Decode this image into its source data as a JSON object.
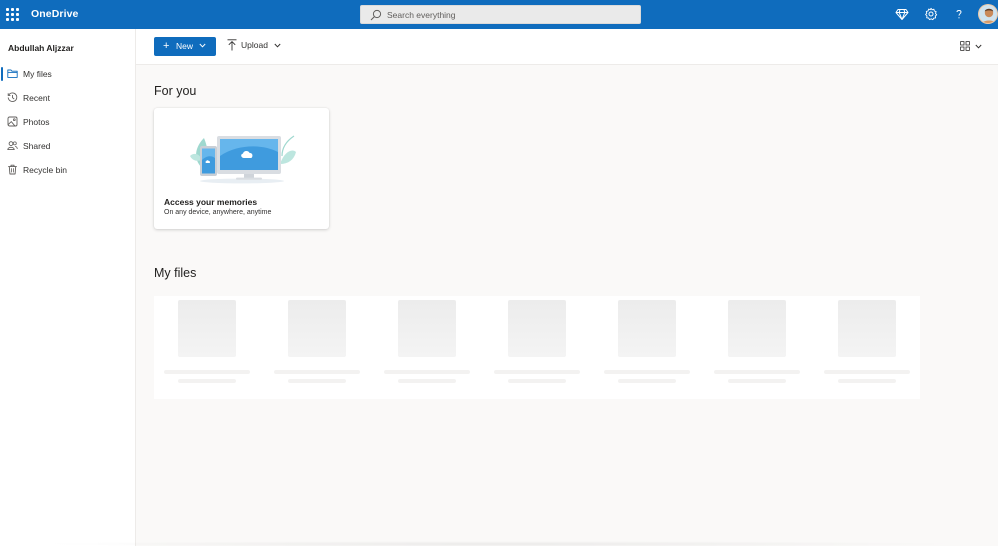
{
  "app": {
    "name": "OneDrive"
  },
  "search": {
    "placeholder": "Search everything"
  },
  "header_icons": [
    "diamond-icon",
    "gear-icon",
    "help-icon",
    "avatar"
  ],
  "user": {
    "name": "Abdullah Aljzzar"
  },
  "nav": {
    "items": [
      {
        "label": "My files",
        "icon": "folder-icon",
        "active": true
      },
      {
        "label": "Recent",
        "icon": "recent-icon",
        "active": false
      },
      {
        "label": "Photos",
        "icon": "photos-icon",
        "active": false
      },
      {
        "label": "Shared",
        "icon": "shared-icon",
        "active": false
      },
      {
        "label": "Recycle bin",
        "icon": "trash-icon",
        "active": false
      }
    ]
  },
  "toolbar": {
    "new_label": "New",
    "upload_label": "Upload"
  },
  "for_you": {
    "title": "For you",
    "card": {
      "title": "Access your memories",
      "subtitle": "On any device, anywhere, anytime"
    }
  },
  "my_files": {
    "title": "My files",
    "placeholder_tiles": 7
  },
  "colors": {
    "brand": "#0f6cbd",
    "background": "#faf9f8"
  }
}
